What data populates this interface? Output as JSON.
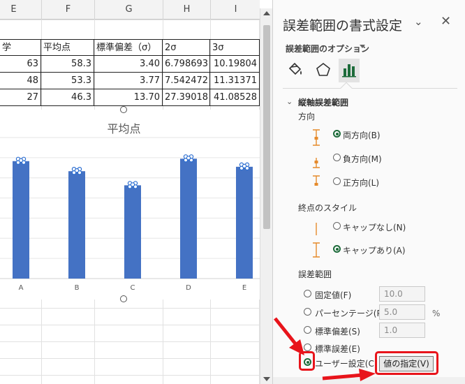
{
  "spreadsheet": {
    "columns": [
      "E",
      "F",
      "G",
      "H",
      "I"
    ],
    "table": {
      "headers": [
        "学",
        "平均点",
        "標準偏差（σ）",
        "2σ",
        "3σ"
      ],
      "rows": [
        [
          "63",
          "58.3",
          "3.40",
          "6.798693",
          "10.19804"
        ],
        [
          "48",
          "53.3",
          "3.77",
          "7.542472",
          "11.31371"
        ],
        [
          "27",
          "46.3",
          "13.70",
          "27.39018",
          "41.08528"
        ]
      ]
    }
  },
  "chart_data": {
    "type": "bar",
    "title": "平均点",
    "categories": [
      "A",
      "B",
      "C",
      "D",
      "E"
    ],
    "values": [
      58.3,
      53.3,
      46.3,
      59.5,
      55.5
    ],
    "ylim": [
      0,
      70
    ],
    "grid": true,
    "bar_color": "#4472c4",
    "error_bar_markers": true
  },
  "pane": {
    "title": "誤差範囲の書式設定",
    "options_label": "誤差範囲のオプション",
    "section": "縦軸誤差範囲",
    "direction": {
      "label": "方向",
      "options": [
        "両方向(B)",
        "負方向(M)",
        "正方向(L)"
      ],
      "selected": 0
    },
    "endstyle": {
      "label": "終点のスタイル",
      "options": [
        "キャップなし(N)",
        "キャップあり(A)"
      ],
      "selected": 1
    },
    "amount": {
      "label": "誤差範囲",
      "options": [
        "固定値(F)",
        "パーセンテージ(P)",
        "標準偏差(S)",
        "標準誤差(E)",
        "ユーザー設定(C)"
      ],
      "selected": 4,
      "fixed_value": "10.0",
      "percentage": "5.0",
      "percent_sign": "%",
      "stddev": "1.0",
      "value_button": "値の指定(V)"
    }
  },
  "colors": {
    "accent_green": "#1d6b3a",
    "annotation_red": "#e8141b",
    "icon_orange": "#e58a2b"
  }
}
